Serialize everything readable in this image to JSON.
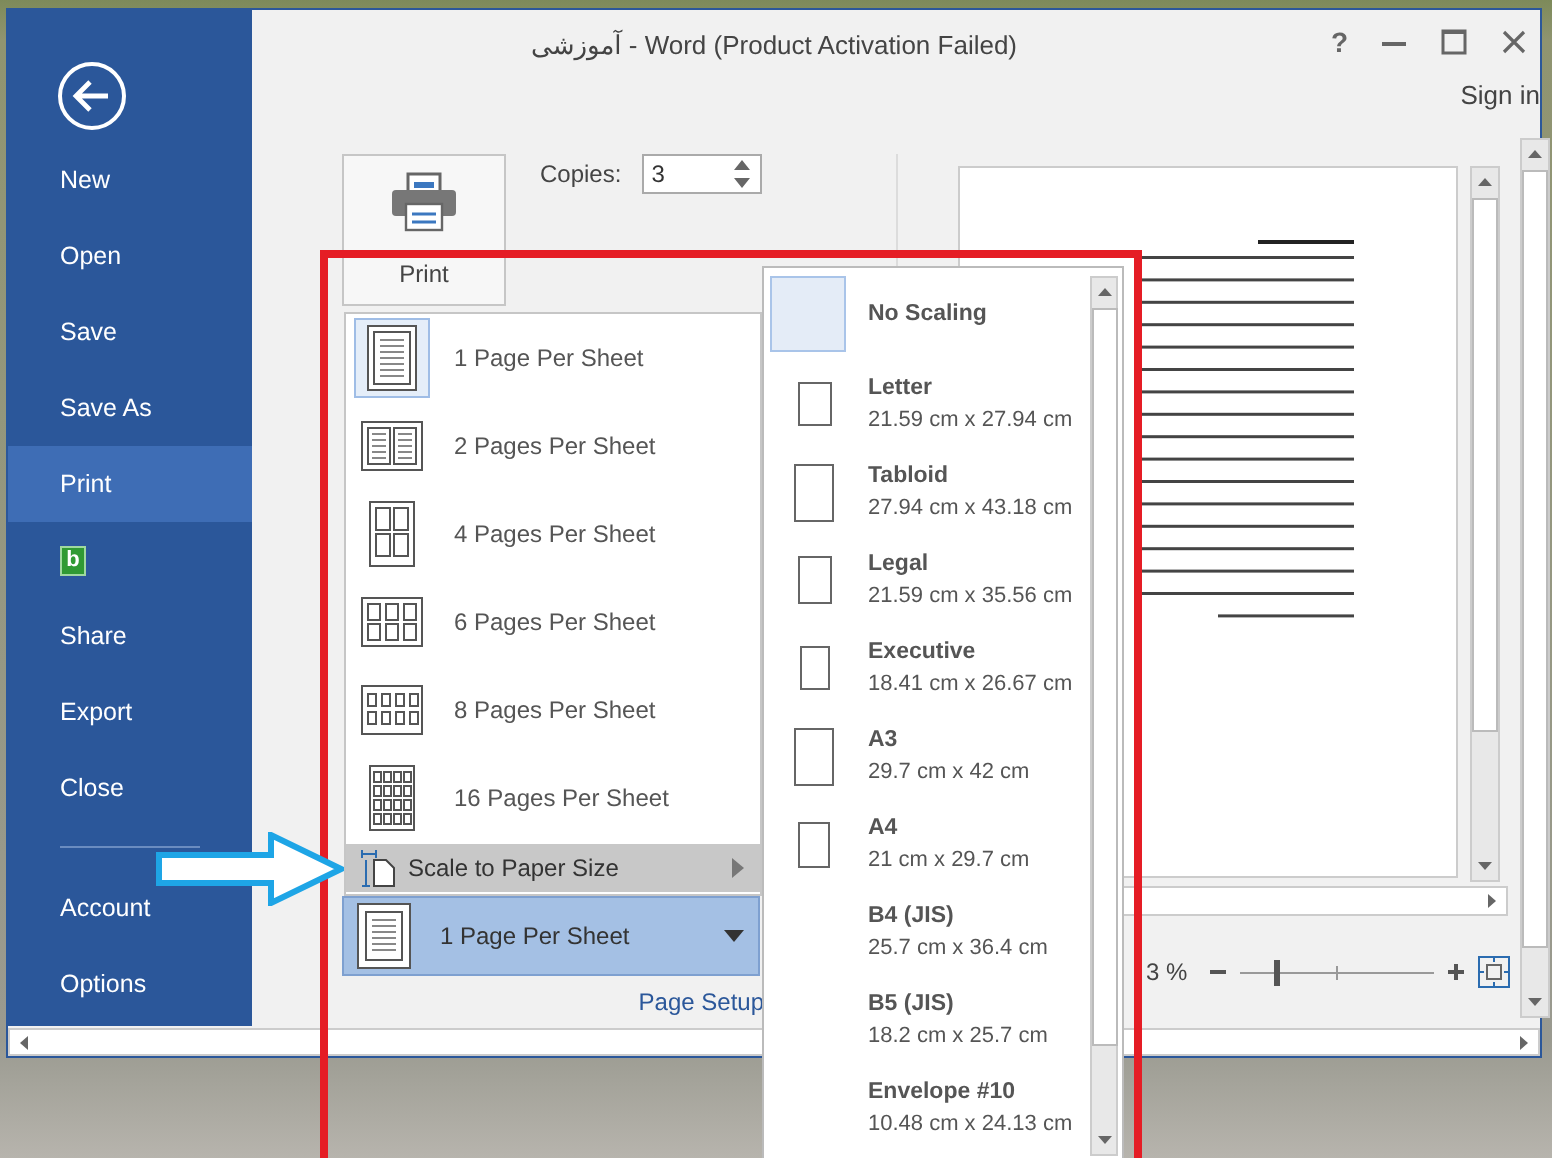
{
  "window": {
    "title": "آموزشی - Word (Product Activation Failed)",
    "help": "?",
    "sign_in": "Sign in"
  },
  "sidebar": {
    "items": [
      {
        "kind": "text",
        "label": "New",
        "selected": false
      },
      {
        "kind": "text",
        "label": "Open",
        "selected": false
      },
      {
        "kind": "text",
        "label": "Save",
        "selected": false
      },
      {
        "kind": "text",
        "label": "Save As",
        "selected": false
      },
      {
        "kind": "text",
        "label": "Print",
        "selected": true
      },
      {
        "kind": "icon",
        "glyph": "b",
        "selected": false
      },
      {
        "kind": "text",
        "label": "Share",
        "selected": false
      },
      {
        "kind": "text",
        "label": "Export",
        "selected": false
      },
      {
        "kind": "text",
        "label": "Close",
        "selected": false
      }
    ],
    "footer_items": [
      {
        "label": "Account",
        "selected": false
      },
      {
        "label": "Options",
        "selected": false
      }
    ]
  },
  "print_button": {
    "label": "Print"
  },
  "copies": {
    "label": "Copies:",
    "value": "3"
  },
  "pages_menu": {
    "items": [
      {
        "kind": "one",
        "label": "1 Page Per Sheet",
        "selected": true
      },
      {
        "kind": "two",
        "label": "2 Pages Per Sheet",
        "selected": false
      },
      {
        "kind": "four",
        "label": "4 Pages Per Sheet",
        "selected": false
      },
      {
        "kind": "six",
        "label": "6 Pages Per Sheet",
        "selected": false
      },
      {
        "kind": "eight",
        "label": "8 Pages Per Sheet",
        "selected": false
      },
      {
        "kind": "sixteen",
        "label": "16 Pages Per Sheet",
        "selected": false
      }
    ],
    "submenu": {
      "label": "Scale to Paper Size",
      "hovered": true
    }
  },
  "pages_dropdown": {
    "value": "1 Page Per Sheet"
  },
  "page_setup_link": "Page Setup",
  "paper_menu": {
    "items": [
      {
        "kind": "none",
        "name": "No Scaling",
        "selected": true
      },
      {
        "kind": "letter",
        "name": "Letter",
        "size": "21.59 cm x 27.94 cm",
        "selected": false
      },
      {
        "kind": "tabloid",
        "name": "Tabloid",
        "size": "27.94 cm x 43.18 cm",
        "selected": false
      },
      {
        "kind": "legal",
        "name": "Legal",
        "size": "21.59 cm x 35.56 cm",
        "selected": false
      },
      {
        "kind": "executive",
        "name": "Executive",
        "size": "18.41 cm x 26.67 cm",
        "selected": false
      },
      {
        "kind": "a3",
        "name": "A3",
        "size": "29.7 cm x 42 cm",
        "selected": false
      },
      {
        "kind": "a4",
        "name": "A4",
        "size": "21 cm x 29.7 cm",
        "selected": false
      },
      {
        "kind": "blank",
        "name": "B4 (JIS)",
        "size": "25.7 cm x 36.4 cm",
        "selected": false
      },
      {
        "kind": "blank",
        "name": "B5 (JIS)",
        "size": "18.2 cm x 25.7 cm",
        "selected": false
      },
      {
        "kind": "blank",
        "name": "Envelope #10",
        "size": "10.48 cm x 24.13 cm",
        "selected": false
      }
    ]
  },
  "zoom": {
    "reading": "3 %",
    "level": 0.18
  }
}
